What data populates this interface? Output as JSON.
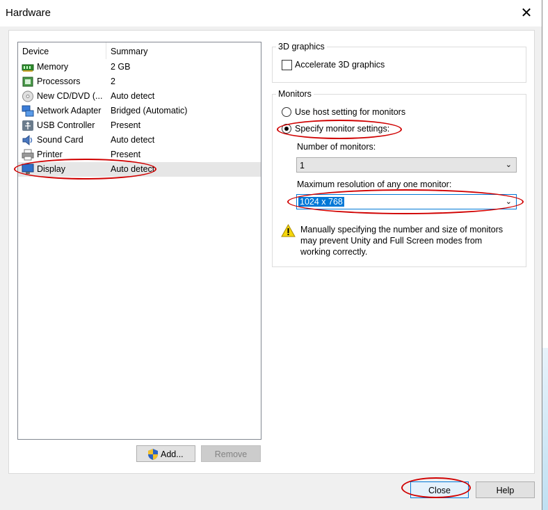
{
  "window": {
    "title": "Hardware",
    "close_glyph": "✕"
  },
  "device_list": {
    "columns": [
      "Device",
      "Summary"
    ],
    "rows": [
      {
        "name": "Memory",
        "summary": "2 GB",
        "icon": "memory-icon"
      },
      {
        "name": "Processors",
        "summary": "2",
        "icon": "processor-icon"
      },
      {
        "name": "New CD/DVD (...",
        "summary": "Auto detect",
        "icon": "cd-dvd-icon"
      },
      {
        "name": "Network Adapter",
        "summary": "Bridged (Automatic)",
        "icon": "network-adapter-icon"
      },
      {
        "name": "USB Controller",
        "summary": "Present",
        "icon": "usb-icon"
      },
      {
        "name": "Sound Card",
        "summary": "Auto detect",
        "icon": "sound-card-icon"
      },
      {
        "name": "Printer",
        "summary": "Present",
        "icon": "printer-icon"
      },
      {
        "name": "Display",
        "summary": "Auto detect",
        "icon": "display-icon",
        "selected": true
      }
    ]
  },
  "buttons": {
    "add": "Add...",
    "remove": "Remove",
    "close": "Close",
    "help": "Help"
  },
  "graphics": {
    "legend": "3D graphics",
    "accelerate_label": "Accelerate 3D graphics",
    "accelerate_checked": false
  },
  "monitors": {
    "legend": "Monitors",
    "use_host_label": "Use host setting for monitors",
    "specify_label": "Specify monitor settings:",
    "selected_option": "specify",
    "number_label": "Number of monitors:",
    "number_value": "1",
    "resolution_label": "Maximum resolution of any one monitor:",
    "resolution_value": "1024 x 768",
    "warning_lines": [
      "Manually specifying the number and size of monitors",
      "may prevent Unity and Full Screen modes from",
      "working correctly."
    ]
  },
  "colors": {
    "annotation_red": "#d00000",
    "selection_blue": "#0078d7"
  }
}
